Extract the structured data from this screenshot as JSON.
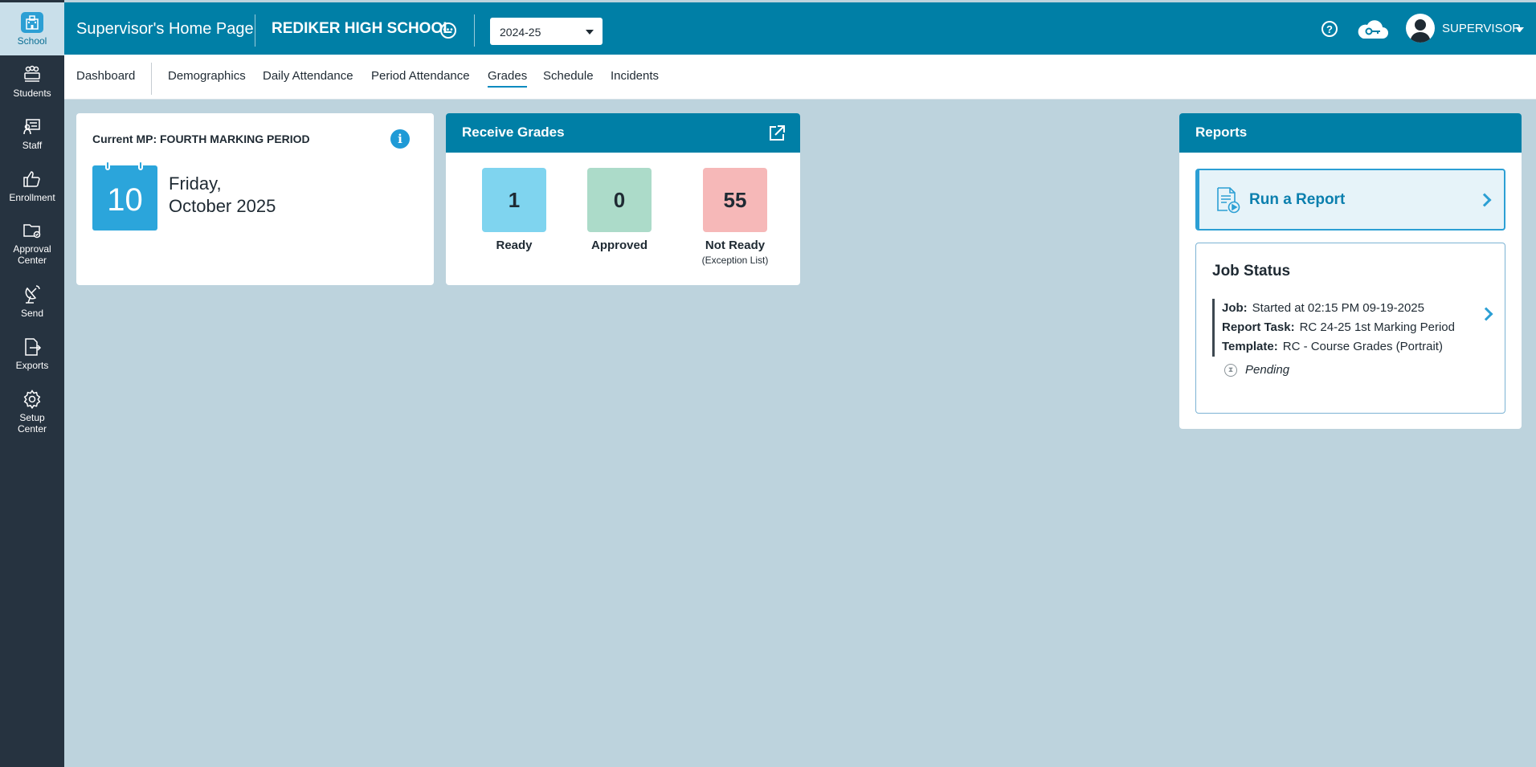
{
  "rail": {
    "items": [
      {
        "label": "School",
        "icon": "school-icon",
        "active": true
      },
      {
        "label": "Students",
        "icon": "students-icon"
      },
      {
        "label": "Staff",
        "icon": "staff-icon"
      },
      {
        "label": "Enrollment",
        "icon": "thumbs-up-icon"
      },
      {
        "label": "Approval\nCenter",
        "icon": "approval-folder-icon"
      },
      {
        "label": "Send",
        "icon": "send-antenna-icon"
      },
      {
        "label": "Exports",
        "icon": "export-file-icon"
      },
      {
        "label": "Setup\nCenter",
        "icon": "gear-icon"
      }
    ]
  },
  "header": {
    "title": "Supervisor's Home Page",
    "school": "REDIKER HIGH SCHOOL",
    "year": "2024-25",
    "user": "SUPERVISOR"
  },
  "subnav": {
    "tabs": [
      "Dashboard",
      "Demographics",
      "Daily Attendance",
      "Period Attendance",
      "Grades",
      "Schedule",
      "Incidents"
    ],
    "active": "Grades"
  },
  "marking_period": {
    "label": "Current MP: FOURTH MARKING PERIOD",
    "day_number": "10",
    "weekday": "Friday,",
    "month_year": "October 2025"
  },
  "receive_grades": {
    "title": "Receive Grades",
    "stats": [
      {
        "value": "1",
        "label": "Ready",
        "sub": "",
        "color": "#7fd4ef"
      },
      {
        "value": "0",
        "label": "Approved",
        "sub": "",
        "color": "#acdbc9"
      },
      {
        "value": "55",
        "label": "Not Ready",
        "sub": "(Exception List)",
        "color": "#f6b8b8"
      }
    ]
  },
  "reports": {
    "title": "Reports",
    "run_report": "Run a Report",
    "job_status": {
      "title": "Job Status",
      "job_label": "Job:",
      "job_value": "Started at 02:15 PM 09-19-2025",
      "task_label": "Report Task:",
      "task_value": "RC 24-25 1st Marking Period",
      "template_label": "Template:",
      "template_value": "RC - Course Grades (Portrait)",
      "status": "Pending"
    }
  },
  "colors": {
    "brand": "#007fa6",
    "rail": "#263340",
    "background": "#bdd3dd",
    "accent": "#2c9fd4"
  }
}
